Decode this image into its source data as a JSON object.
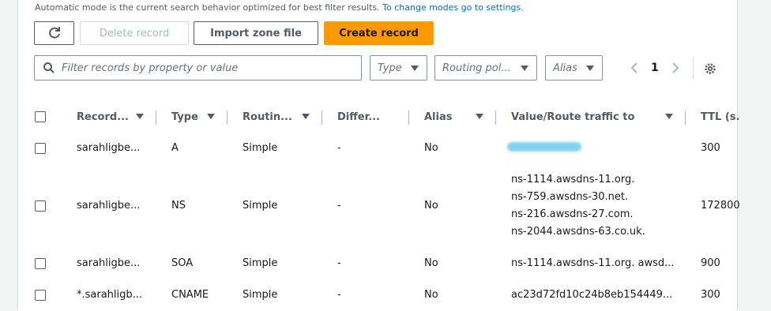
{
  "info": {
    "text": "Automatic mode is the current search behavior optimized for best filter results.",
    "link": "To change modes go to settings."
  },
  "toolbar": {
    "refresh_icon": "refresh-icon",
    "delete_label": "Delete record",
    "import_label": "Import zone file",
    "create_label": "Create record"
  },
  "filters": {
    "search_placeholder": "Filter records by property or value",
    "type": "Type",
    "routing": "Routing pol...",
    "alias": "Alias"
  },
  "pagination": {
    "page": "1"
  },
  "columns": {
    "record": "Record...",
    "type": "Type",
    "routing": "Routin...",
    "differ": "Differ...",
    "alias": "Alias",
    "value": "Value/Route traffic to",
    "ttl": "TTL (s."
  },
  "rows": [
    {
      "name": "sarahligbe...",
      "type": "A",
      "routing": "Simple",
      "differ": "-",
      "alias": "No",
      "value": [],
      "ttl": "300"
    },
    {
      "name": "sarahligbe...",
      "type": "NS",
      "routing": "Simple",
      "differ": "-",
      "alias": "No",
      "value": [
        "ns-1114.awsdns-11.org.",
        "ns-759.awsdns-30.net.",
        "ns-216.awsdns-27.com.",
        "ns-2044.awsdns-63.co.uk."
      ],
      "ttl": "172800"
    },
    {
      "name": "sarahligbe...",
      "type": "SOA",
      "routing": "Simple",
      "differ": "-",
      "alias": "No",
      "value": [
        "ns-1114.awsdns-11.org. awsd..."
      ],
      "ttl": "900"
    },
    {
      "name": "*.sarahligb...",
      "type": "CNAME",
      "routing": "Simple",
      "differ": "-",
      "alias": "No",
      "value": [
        "ac23d72fd10c24b8eb154449..."
      ],
      "ttl": "300"
    }
  ]
}
